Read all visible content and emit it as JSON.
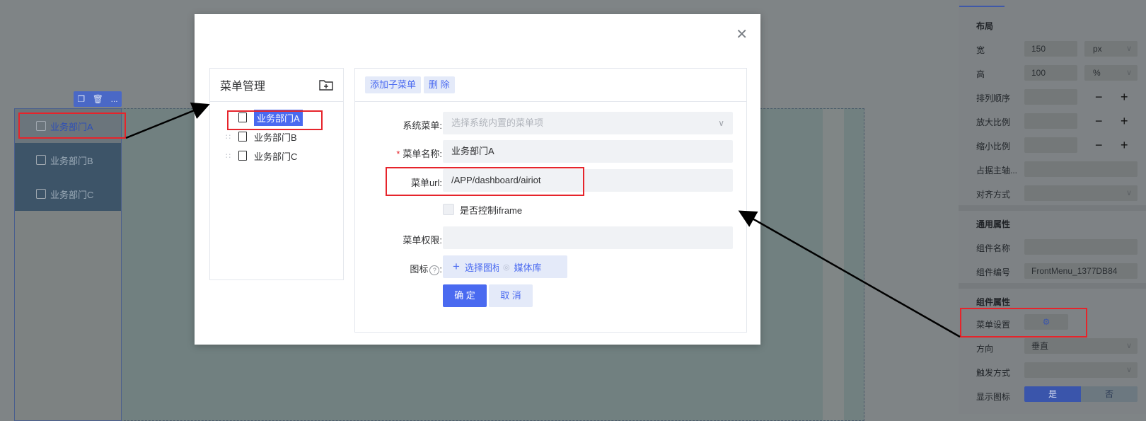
{
  "canvas": {
    "toolbar": {
      "copy_icon": "copy-icon",
      "delete_icon": "trash-icon",
      "more_label": "..."
    },
    "menu_items": [
      {
        "label": "业务部门A",
        "active": true
      },
      {
        "label": "业务部门B",
        "active": false
      },
      {
        "label": "业务部门C",
        "active": false
      }
    ]
  },
  "dialog": {
    "tree": {
      "title": "菜单管理",
      "add_folder_icon": "folder-add-icon",
      "nodes": [
        {
          "label": "业务部门A",
          "selected": true
        },
        {
          "label": "业务部门B",
          "selected": false
        },
        {
          "label": "业务部门C",
          "selected": false
        }
      ]
    },
    "toolbar": {
      "add_child": "添加子菜单",
      "delete": "删 除"
    },
    "form": {
      "system_menu_label": "系统菜单:",
      "system_menu_placeholder": "选择系统内置的菜单项",
      "menu_name_label": "菜单名称:",
      "menu_name_value": "业务部门A",
      "menu_url_label": "菜单url:",
      "menu_url_value": "/APP/dashboard/airiot",
      "iframe_label": "是否控制iframe",
      "permission_label": "菜单权限:",
      "permission_value": "",
      "icon_label": "图标",
      "choose_icon": "选择图标",
      "media_library": "媒体库",
      "confirm": "确 定",
      "cancel": "取 消"
    }
  },
  "panel": {
    "layout_title": "布局",
    "width_label": "宽",
    "width_value": "150",
    "width_unit": "px",
    "height_label": "高",
    "height_value": "100",
    "height_unit": "%",
    "order_label": "排列顺序",
    "grow_label": "放大比例",
    "shrink_label": "缩小比例",
    "basis_label": "占据主轴...",
    "align_label": "对齐方式",
    "general_title": "通用属性",
    "name_label": "组件名称",
    "name_value": "",
    "id_label": "组件编号",
    "id_value": "FrontMenu_1377DB84",
    "component_title": "组件属性",
    "menu_settings_label": "菜单设置",
    "direction_label": "方向",
    "direction_value": "垂直",
    "trigger_label": "触发方式",
    "trigger_value": "",
    "show_icon_label": "显示图标",
    "show_icon_yes": "是",
    "show_icon_no": "否",
    "minus": "−",
    "plus": "+"
  },
  "colors": {
    "accent": "#4a6af0",
    "annotation": "#e6242b"
  }
}
